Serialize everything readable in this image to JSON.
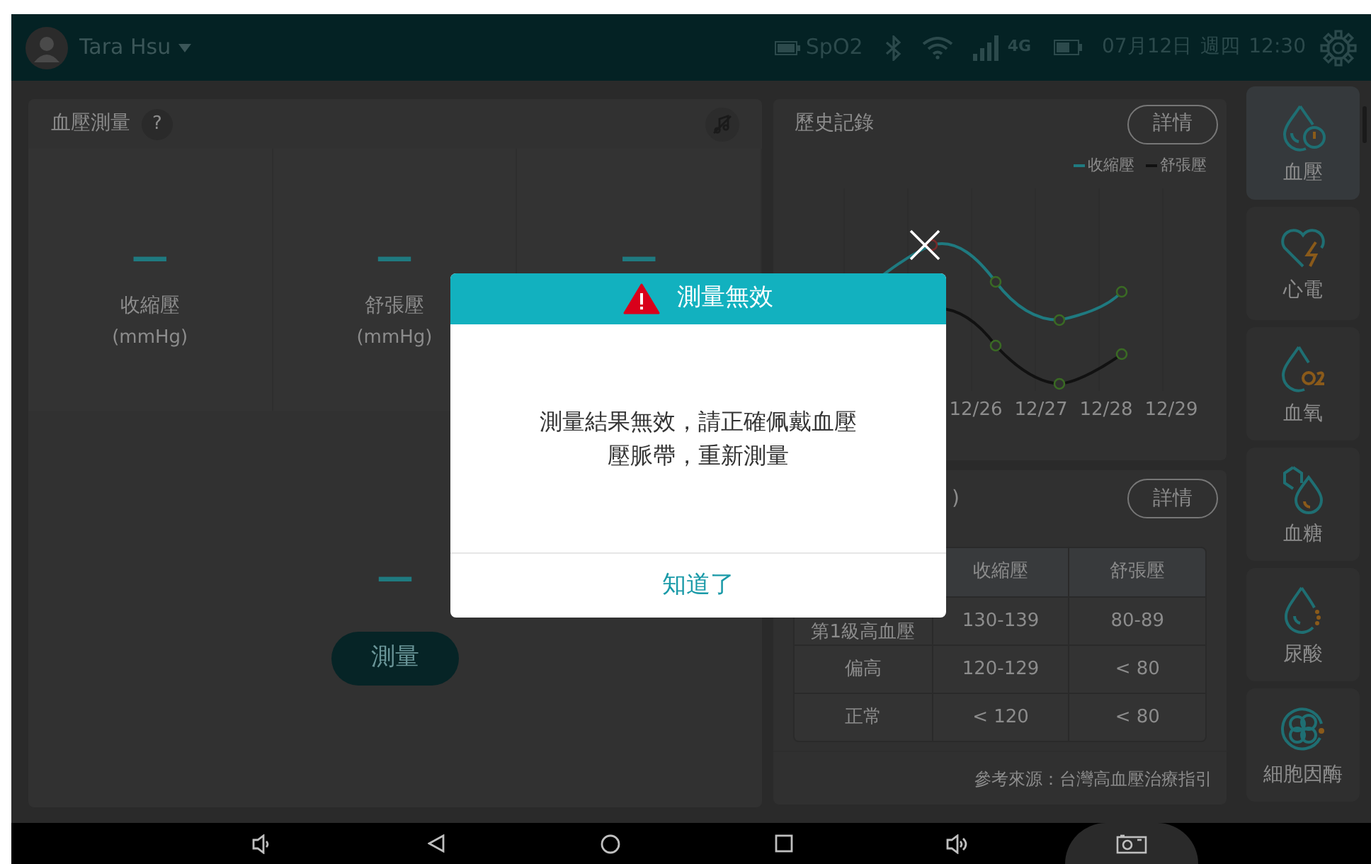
{
  "status_bar": {
    "user": "Tara Hsu",
    "spo2": "SpO2",
    "network": "4G",
    "date": "07月12日",
    "weekday": "週四",
    "time": "12:30"
  },
  "measure_panel": {
    "title": "血壓測量",
    "help": "?",
    "gauges": [
      {
        "value": "—",
        "label": "收縮壓",
        "unit": "(mmHg)"
      },
      {
        "value": "—",
        "label": "舒張壓",
        "unit": "(mmHg)"
      },
      {
        "value": "—"
      }
    ],
    "pulse_value": "—",
    "button": "測量"
  },
  "history": {
    "title": "歷史記錄",
    "button": "詳情",
    "legend": [
      {
        "name": "收縮壓",
        "color": "#1f7a80"
      },
      {
        "name": "舒張壓",
        "color": "#111111"
      }
    ],
    "x_labels": [
      "12/26",
      "12/27",
      "12/28",
      "12/29"
    ]
  },
  "reference": {
    "title": ")",
    "button": "詳情",
    "columns": [
      "",
      "收縮壓",
      "舒張壓"
    ],
    "rows": [
      [
        "第1級高血壓",
        "130-139",
        "80-89"
      ],
      [
        "偏高",
        "120-129",
        "< 80"
      ],
      [
        "正常",
        "< 120",
        "< 80"
      ]
    ],
    "source": "參考來源：台灣高血壓治療指引"
  },
  "sidebar": {
    "items": [
      {
        "kind": "pressure",
        "label": "血壓",
        "selected": true
      },
      {
        "kind": "ecg",
        "label": "心電",
        "selected": false
      },
      {
        "kind": "oxygen",
        "label": "血氧",
        "selected": false
      },
      {
        "kind": "glucose",
        "label": "血糖",
        "selected": false
      },
      {
        "kind": "uric",
        "label": "尿酸",
        "selected": false
      },
      {
        "kind": "cell",
        "label": "細胞因酶",
        "selected": false
      }
    ]
  },
  "dialog": {
    "title": "測量無效",
    "message_lines": [
      "測量結果無效，請正確佩戴血壓",
      "壓脈帶，重新測量"
    ],
    "button": "知道了"
  }
}
